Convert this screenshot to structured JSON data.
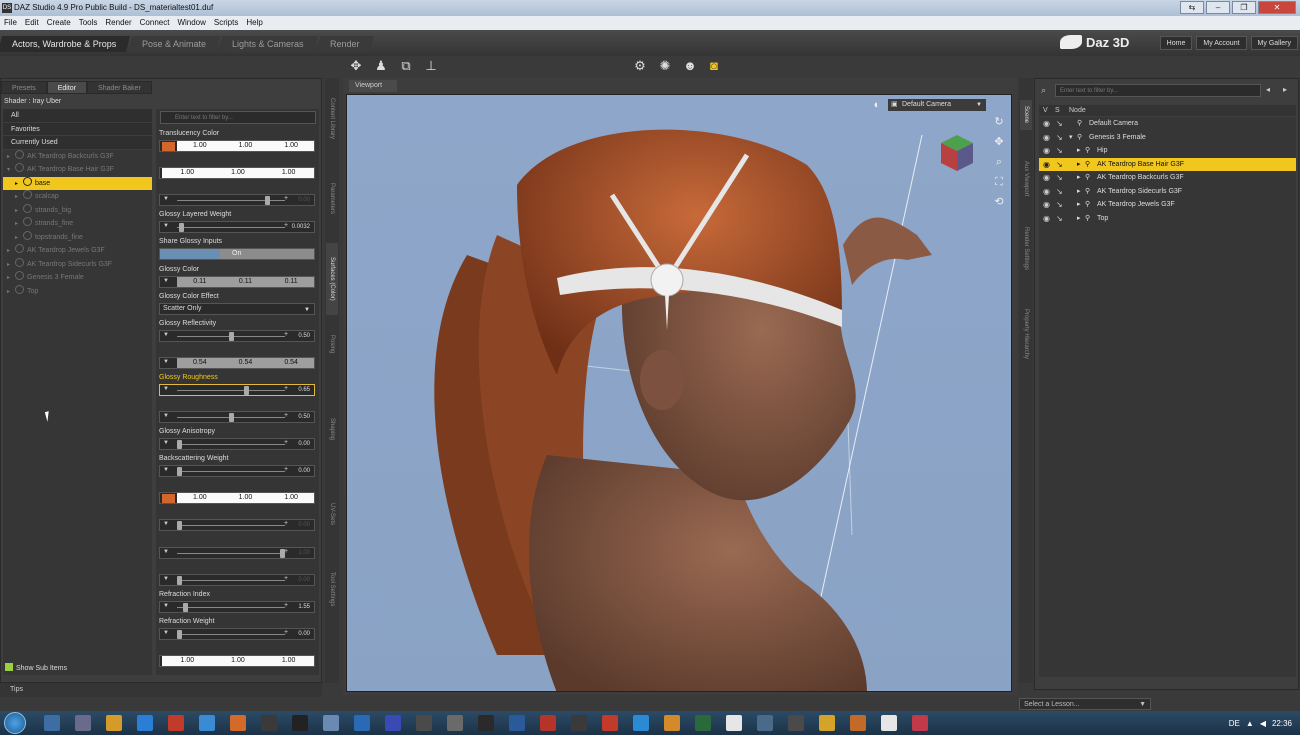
{
  "window": {
    "title": "DAZ Studio 4.9 Pro Public Build - DS_materialtest01.duf",
    "app_icon": "DS",
    "buttons": [
      "⇆",
      "–",
      "❐",
      "✕"
    ]
  },
  "menu": [
    "File",
    "Edit",
    "Create",
    "Tools",
    "Render",
    "Connect",
    "Window",
    "Scripts",
    "Help"
  ],
  "rooms": [
    "Actors, Wardrobe & Props",
    "Pose & Animate",
    "Lights & Cameras",
    "Render"
  ],
  "brand": "Daz 3D",
  "header_links": [
    "Home",
    "My Account",
    "My Gallery"
  ],
  "left_panel": {
    "tabs": [
      "Presets",
      "Editor",
      "Shader Baker"
    ],
    "active_tab": "Editor",
    "shader_label": "Shader : Iray Uber",
    "tree": [
      {
        "label": "All",
        "type": "header"
      },
      {
        "label": "Favorites",
        "type": "header"
      },
      {
        "label": "Currently Used",
        "type": "header"
      },
      {
        "label": "AK Teardrop Backcurls G3F",
        "type": "item",
        "indent": 0,
        "arrow": "▸"
      },
      {
        "label": "AK Teardrop Base Hair G3F",
        "type": "item",
        "indent": 0,
        "arrow": "▾"
      },
      {
        "label": "base",
        "type": "selected",
        "indent": 1,
        "arrow": "▸"
      },
      {
        "label": "scalcap",
        "type": "item",
        "indent": 1,
        "arrow": "▸"
      },
      {
        "label": "strands_big",
        "type": "item",
        "indent": 1,
        "arrow": "▸"
      },
      {
        "label": "strands_fine",
        "type": "item",
        "indent": 1,
        "arrow": "▸"
      },
      {
        "label": "topstrands_fine",
        "type": "item",
        "indent": 1,
        "arrow": "▸"
      },
      {
        "label": "AK Teardrop Jewels G3F",
        "type": "item",
        "indent": 0,
        "arrow": "▸"
      },
      {
        "label": "AK Teardrop Sidecurls G3F",
        "type": "item",
        "indent": 0,
        "arrow": "▸"
      },
      {
        "label": "Genesis 3 Female",
        "type": "item",
        "indent": 0,
        "arrow": "▸"
      },
      {
        "label": "Top",
        "type": "item",
        "indent": 0,
        "arrow": "▸"
      }
    ],
    "show_sub_items": "Show Sub Items",
    "filter_placeholder": "Enter text to filter by...",
    "properties": [
      {
        "label": "Translucency Color",
        "kind": "color",
        "values": [
          "1.00",
          "1.00",
          "1.00"
        ],
        "swatch": "#d2662c"
      },
      {
        "label": "",
        "kind": "color-noswatch",
        "values": [
          "1.00",
          "1.00",
          "1.00"
        ]
      },
      {
        "label": "",
        "kind": "slider",
        "value": "0.00",
        "pos": 0.85,
        "dim": true
      },
      {
        "label": "Glossy Layered Weight",
        "kind": "slider",
        "value": "0.0032",
        "pos": 0.02
      },
      {
        "label": "Share Glossy Inputs",
        "kind": "toggle",
        "value": "On"
      },
      {
        "label": "Glossy Color",
        "kind": "color-gray",
        "values": [
          "0.11",
          "0.11",
          "0.11"
        ]
      },
      {
        "label": "Glossy Color Effect",
        "kind": "dropdown",
        "value": "Scatter Only"
      },
      {
        "label": "Glossy Reflectivity",
        "kind": "slider",
        "value": "0.50",
        "pos": 0.5
      },
      {
        "label": "",
        "kind": "color-gray",
        "values": [
          "0.54",
          "0.54",
          "0.54"
        ]
      },
      {
        "label": "Glossy Roughness",
        "kind": "slider",
        "value": "0.65",
        "pos": 0.65,
        "highlight": true
      },
      {
        "label": "",
        "kind": "slider",
        "value": "0.50",
        "pos": 0.5
      },
      {
        "label": "Glossy Anisotropy",
        "kind": "slider",
        "value": "0.00",
        "pos": 0.0
      },
      {
        "label": "Backscattering Weight",
        "kind": "slider",
        "value": "0.00",
        "pos": 0.0
      },
      {
        "label": "",
        "kind": "color",
        "values": [
          "1.00",
          "1.00",
          "1.00"
        ],
        "swatch": "#d2662c"
      },
      {
        "label": "",
        "kind": "slider",
        "value": "0.00",
        "pos": 0.0,
        "dim": true
      },
      {
        "label": "",
        "kind": "slider",
        "value": "1.00",
        "pos": 1.0,
        "dim": true
      },
      {
        "label": "",
        "kind": "slider",
        "value": "0.00",
        "pos": 0.0,
        "dim": true
      },
      {
        "label": "Refraction Index",
        "kind": "slider",
        "value": "1.55",
        "pos": 0.06
      },
      {
        "label": "Refraction Weight",
        "kind": "slider",
        "value": "0.00",
        "pos": 0.0
      },
      {
        "label": "",
        "kind": "color-noswatch",
        "values": [
          "1.00",
          "1.00",
          "1.00"
        ]
      }
    ],
    "vertical_tabs": [
      "Content Library",
      "Parameters",
      "Surfaces (Color)",
      "Posing",
      "Shaping",
      "UV-Sets",
      "Tool Settings"
    ],
    "tips": "Tips"
  },
  "viewport": {
    "tab": "Viewport",
    "camera": "Default Camera"
  },
  "scene": {
    "filter_placeholder": "Enter text to filter by...",
    "columns": [
      "V",
      "S",
      "Node"
    ],
    "nodes": [
      {
        "label": "Default Camera",
        "indent": 0,
        "arrow": ""
      },
      {
        "label": "Genesis 3 Female",
        "indent": 0,
        "arrow": "▾"
      },
      {
        "label": "Hip",
        "indent": 1,
        "arrow": "▸"
      },
      {
        "label": "AK Teardrop Base Hair G3F",
        "indent": 1,
        "arrow": "▸",
        "selected": true
      },
      {
        "label": "AK Teardrop Backcurls G3F",
        "indent": 1,
        "arrow": "▸"
      },
      {
        "label": "AK Teardrop Sidecurls G3F",
        "indent": 1,
        "arrow": "▸"
      },
      {
        "label": "AK Teardrop Jewels G3F",
        "indent": 1,
        "arrow": "▸"
      },
      {
        "label": "Top",
        "indent": 1,
        "arrow": "▸"
      }
    ],
    "vertical_tabs": [
      "Scene",
      "Aux Viewport",
      "Render Settings",
      "Property Hierarchy"
    ],
    "lesson_placeholder": "Select a Lesson..."
  },
  "taskbar": {
    "language": "DE",
    "time": "22:36"
  },
  "colors": {
    "selection": "#f2c71d",
    "viewport_bg": "#8ea6c9",
    "panel_bg": "#3e3e3e"
  }
}
